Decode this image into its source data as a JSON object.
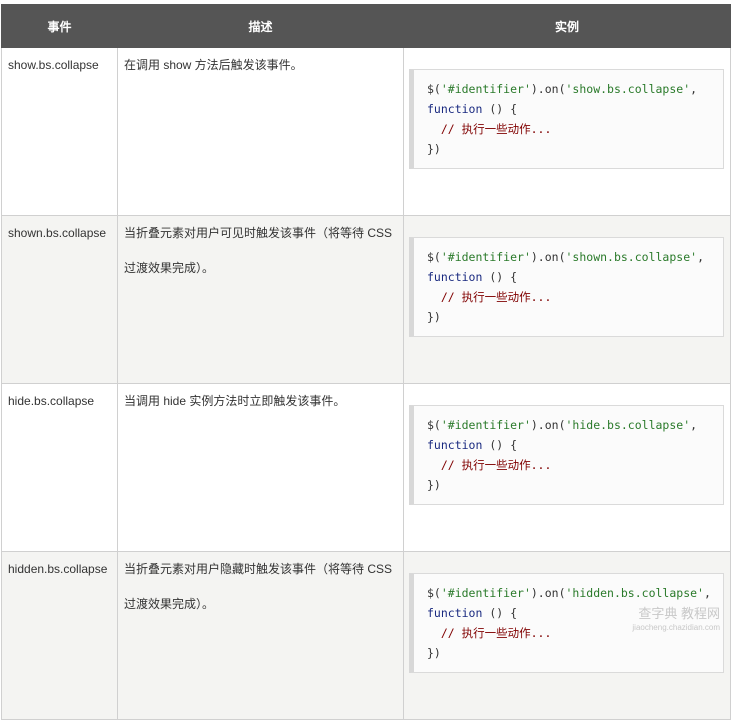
{
  "headers": [
    "事件",
    "描述",
    "实例"
  ],
  "rows": [
    {
      "event": "show.bs.collapse",
      "description": "在调用 show 方法后触发该事件。",
      "code": {
        "prefix": "$(",
        "selector": "'#identifier'",
        "mid": ").on(",
        "event_str": "'show.bs.collapse'",
        "after_event": ",",
        "fn": "function",
        "fn_rest": " () {",
        "comment": "  // 执行一些动作...",
        "close": "})"
      }
    },
    {
      "event": "shown.bs.collapse",
      "description": "当折叠元素对用户可见时触发该事件（将等待 CSS 过渡效果完成）。",
      "code": {
        "prefix": "$(",
        "selector": "'#identifier'",
        "mid": ").on(",
        "event_str": "'shown.bs.collapse'",
        "after_event": ",",
        "fn": "function",
        "fn_rest": " () {",
        "comment": "  // 执行一些动作...",
        "close": "})"
      }
    },
    {
      "event": "hide.bs.collapse",
      "description": "当调用 hide 实例方法时立即触发该事件。",
      "code": {
        "prefix": "$(",
        "selector": "'#identifier'",
        "mid": ").on(",
        "event_str": "'hide.bs.collapse'",
        "after_event": ",",
        "fn": "function",
        "fn_rest": " () {",
        "comment": "  // 执行一些动作...",
        "close": "})"
      }
    },
    {
      "event": "hidden.bs.collapse",
      "description": "当折叠元素对用户隐藏时触发该事件（将等待 CSS 过渡效果完成）。",
      "code": {
        "prefix": "$(",
        "selector": "'#identifier'",
        "mid": ").on(",
        "event_str": "'hidden.bs.collapse'",
        "after_event": ",",
        "fn": "function",
        "fn_rest": " () {",
        "comment": "  // 执行一些动作...",
        "close": "})"
      }
    }
  ],
  "watermark": {
    "main": "查字典 教程网",
    "sub": "jiaocheng.chazidian.com"
  },
  "colors": {
    "header_bg": "#555555",
    "alt_row_bg": "#f4f4f2",
    "string": "#2a7a2a",
    "keyword": "#1a2a80",
    "comment": "#800000"
  }
}
